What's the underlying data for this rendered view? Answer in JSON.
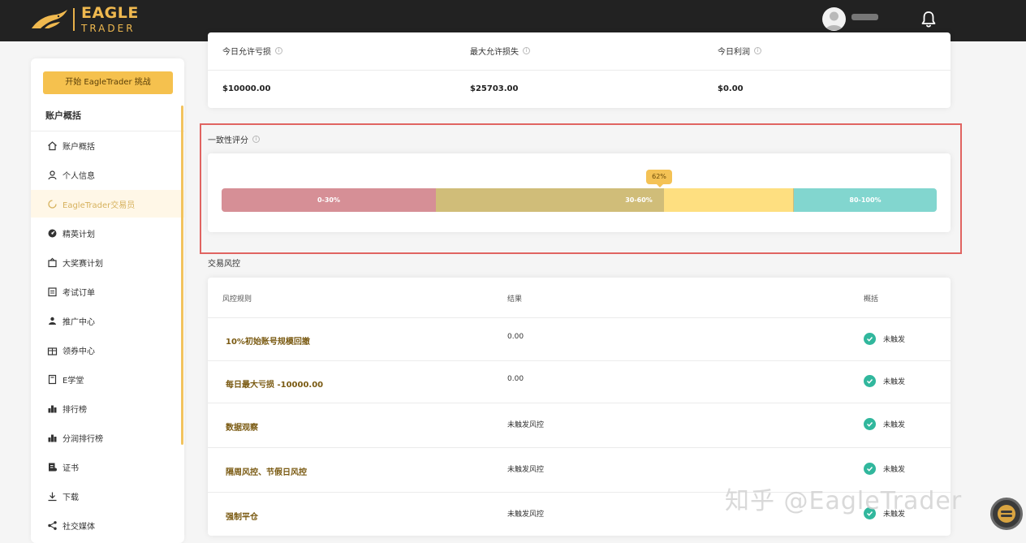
{
  "brand": {
    "line1": "EAGLE",
    "line2": "TRADER",
    "accent": "#f0b94f"
  },
  "header": {
    "username_masked": "",
    "avatar_icon": "user-avatar",
    "bell_icon": "bell-icon"
  },
  "sidebar": {
    "start_button": "开始 EagleTrader 挑战",
    "heading": "账户概括",
    "items": [
      {
        "label": "账户概括",
        "icon": "home-icon",
        "active": false
      },
      {
        "label": "个人信息",
        "icon": "user-icon",
        "active": false
      },
      {
        "label": "EagleTrader交易员",
        "icon": "loading-icon",
        "active": true
      },
      {
        "label": "精英计划",
        "icon": "gauge-icon",
        "active": false
      },
      {
        "label": "大奖赛计划",
        "icon": "trophy-icon",
        "active": false
      },
      {
        "label": "考试订单",
        "icon": "order-icon",
        "active": false
      },
      {
        "label": "推广中心",
        "icon": "people-icon",
        "active": false
      },
      {
        "label": "领券中心",
        "icon": "gift-icon",
        "active": false
      },
      {
        "label": "E学堂",
        "icon": "book-icon",
        "active": false
      },
      {
        "label": "排行榜",
        "icon": "bar-chart-icon",
        "active": false
      },
      {
        "label": "分润排行榜",
        "icon": "bar-chart-icon",
        "active": false
      },
      {
        "label": "证书",
        "icon": "certificate-icon",
        "active": false
      },
      {
        "label": "下载",
        "icon": "download-icon",
        "active": false
      },
      {
        "label": "社交媒体",
        "icon": "share-icon",
        "active": false
      }
    ]
  },
  "stats": {
    "items": [
      {
        "label": "今日允许亏损",
        "value": "$10000.00"
      },
      {
        "label": "最大允许损失",
        "value": "$25703.00"
      },
      {
        "label": "今日利润",
        "value": "$0.00"
      }
    ]
  },
  "consistency": {
    "title": "一致性评分",
    "score_label": "62%",
    "score": 0.62,
    "segments": [
      {
        "label": "0-30%",
        "color": "#d68f96"
      },
      {
        "label": "30-60%",
        "color": "#d0bd79"
      },
      {
        "label": "",
        "color": "#fedf80"
      },
      {
        "label": "80-100%",
        "color": "#82d6cf"
      }
    ]
  },
  "risk": {
    "title": "交易风控",
    "headers": {
      "rule": "风控规则",
      "result": "结果",
      "summary": "概括"
    },
    "rows": [
      {
        "rule": "10%初始账号规模回撤",
        "result": "0.00",
        "status": "未触发"
      },
      {
        "rule": "每日最大亏损 -10000.00",
        "result": "0.00",
        "status": "未触发"
      },
      {
        "rule": "数据观察",
        "result": "未触发风控",
        "status": "未触发"
      },
      {
        "rule": "隔周风控、节假日风控",
        "result": "未触发风控",
        "status": "未触发"
      },
      {
        "rule": "强制平仓",
        "result": "未触发风控",
        "status": "未触发"
      }
    ],
    "status_color": "#31b79d"
  },
  "watermark": "知乎 @EagleTrader"
}
